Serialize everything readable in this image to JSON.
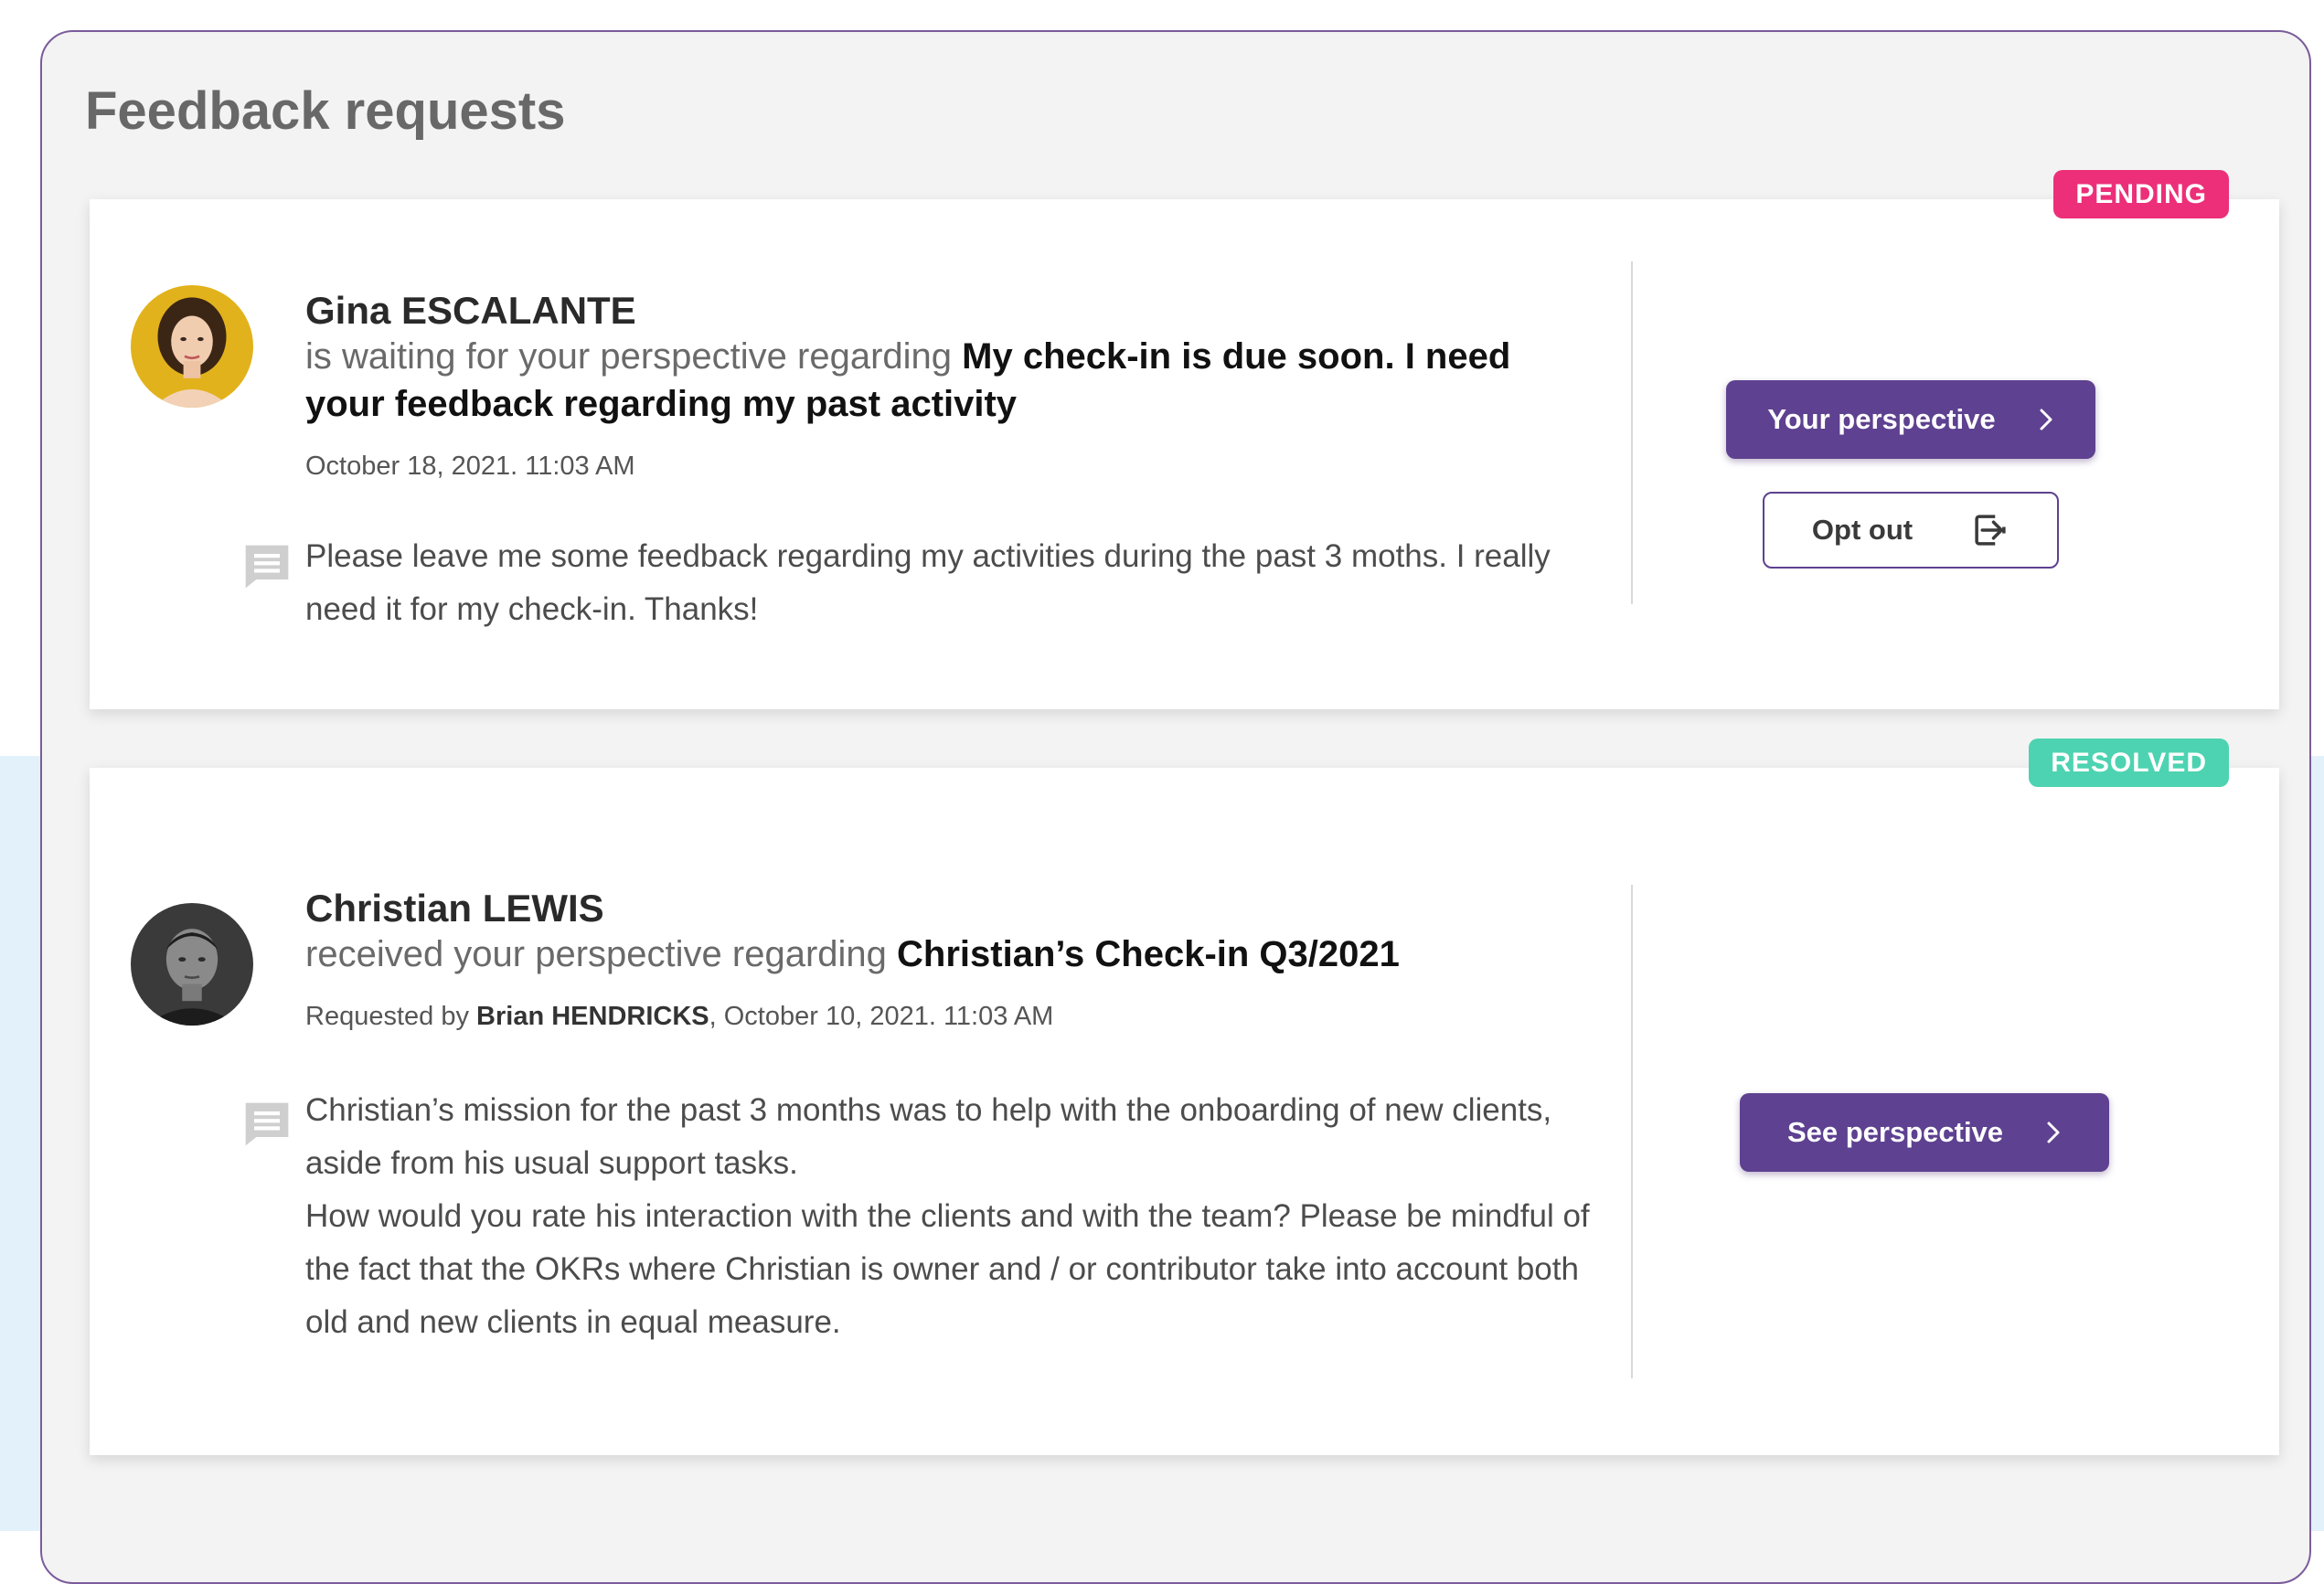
{
  "section": {
    "title": "Feedback requests"
  },
  "colors": {
    "accent": "#5e4190",
    "pending": "#ec2f78",
    "resolved": "#4dd3b1"
  },
  "requests": [
    {
      "status": "PENDING",
      "avatar_icon": "woman-portrait",
      "name": "Gina ESCALANTE",
      "regarding_prefix": "is waiting for your perspective regarding",
      "regarding_subject": "My check-in is due soon. I need your feedback regarding my past activity",
      "date": "October 18, 2021. 11:03 AM",
      "message_icon": "comment-icon",
      "message": [
        "Please leave me some feedback regarding my activities during the past 3 moths. I really need it for my check-in. Thanks!"
      ],
      "primary_button": {
        "label": "Your perspective",
        "icon": "chevron-right-icon"
      },
      "secondary_button": {
        "label": "Opt out",
        "icon": "exit-icon"
      }
    },
    {
      "status": "RESOLVED",
      "avatar_icon": "man-portrait",
      "name": "Christian LEWIS",
      "regarding_prefix": "received  your perspective regarding",
      "regarding_subject": "Christian’s Check-in Q3/2021",
      "requested_by_label": "Requested by",
      "requested_by_name": "Brian HENDRICKS",
      "date": ", October 10, 2021. 11:03 AM",
      "message_icon": "comment-icon",
      "message": [
        "Christian’s mission for the past 3 months was to help with the onboarding of new clients, aside from his usual support tasks.",
        "How would you rate his interaction with the clients and with the team? Please be mindful of the fact that the OKRs where Christian is owner and / or contributor take into account both old and new clients in equal measure."
      ],
      "primary_button": {
        "label": "See perspective",
        "icon": "chevron-right-icon"
      }
    }
  ]
}
